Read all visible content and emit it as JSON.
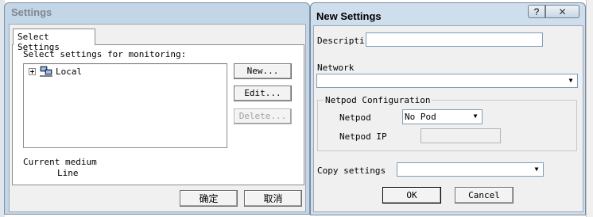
{
  "settings_window": {
    "title": "Settings",
    "tab": "Select Settings",
    "select_label": "Select settings for monitoring:",
    "tree_item": "Local",
    "buttons": {
      "new": "New...",
      "edit": "Edit...",
      "delete": "Delete..."
    },
    "current_medium_label": "Current medium",
    "current_medium_value": "Line",
    "ok": "确定",
    "cancel": "取消"
  },
  "new_settings_window": {
    "title": "New Settings",
    "description_label": "Descriptio",
    "description_value": "",
    "network_label": "Network",
    "network_value": "",
    "netpod_group_title": "Netpod Configuration",
    "netpod_label": "Netpod",
    "netpod_value": "No Pod",
    "netpod_ip_label": "Netpod IP",
    "netpod_ip_value": "",
    "copy_settings_label": "Copy settings",
    "copy_settings_value": "",
    "ok": "OK",
    "cancel": "Cancel",
    "help_glyph": "?",
    "close_glyph": "✕"
  }
}
